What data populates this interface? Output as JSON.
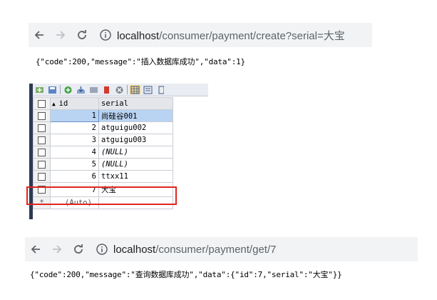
{
  "browser1": {
    "host": "localhost",
    "path": "/consumer/payment/create?serial=大宝"
  },
  "response1": "{\"code\":200,\"message\":\"插入数据库成功\",\"data\":1}",
  "table": {
    "headers": [
      "id",
      "serial"
    ],
    "rows": [
      {
        "id": "1",
        "serial": "尚硅谷001"
      },
      {
        "id": "2",
        "serial": "atguigu002"
      },
      {
        "id": "3",
        "serial": "atguigu003"
      },
      {
        "id": "4",
        "serial": "(NULL)"
      },
      {
        "id": "5",
        "serial": "(NULL)"
      },
      {
        "id": "6",
        "serial": "ttxx11"
      },
      {
        "id": "7",
        "serial": "大宝"
      }
    ],
    "new_row_marker": "*",
    "new_row_id": "(Auto)"
  },
  "browser2": {
    "host": "localhost",
    "path": "/consumer/payment/get/7"
  },
  "response2": "{\"code\":200,\"message\":\"查询数据库成功\",\"data\":{\"id\":7,\"serial\":\"大宝\"}}",
  "colors": {
    "highlight": "#e0261f",
    "selected_row": "#b9d3f3",
    "sidebar": "#2d3a52"
  }
}
